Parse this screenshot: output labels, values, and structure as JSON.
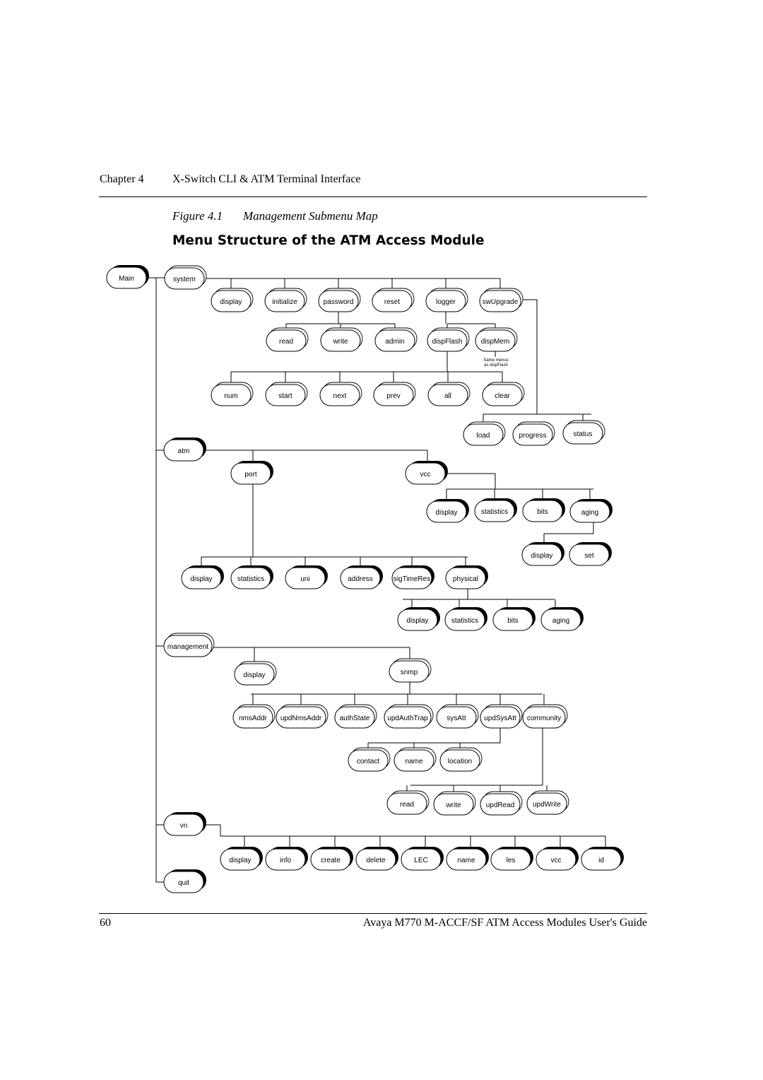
{
  "header": {
    "chapter_label": "Chapter 4",
    "chapter_title": "X-Switch CLI & ATM Terminal Interface"
  },
  "figure": {
    "number": "Figure 4.1",
    "caption": "Management Submenu Map",
    "title": "Menu Structure of the ATM Access Module"
  },
  "footer": {
    "page_number": "60",
    "book_title": "Avaya M770 M-ACCF/SF ATM Access Modules User's Guide"
  },
  "diagram": {
    "node_styles": {
      "menu": "rounded box with heavy black shadow (submenu)",
      "command": "rounded box with double outline (command)"
    },
    "annotation": {
      "text_line1": "Same menus",
      "text_line2": "as dispFlash",
      "attached_to": "dispMem"
    },
    "nodes": [
      {
        "id": "main",
        "label": "Main",
        "style": "menu"
      },
      {
        "id": "system",
        "label": "system",
        "style": "command",
        "parent": "main"
      },
      {
        "id": "sys_display",
        "label": "display",
        "style": "command",
        "parent": "system"
      },
      {
        "id": "sys_initialize",
        "label": "initialize",
        "style": "command",
        "parent": "system"
      },
      {
        "id": "sys_password",
        "label": "password",
        "style": "command",
        "parent": "system"
      },
      {
        "id": "sys_reset",
        "label": "reset",
        "style": "command",
        "parent": "system"
      },
      {
        "id": "sys_logger",
        "label": "logger",
        "style": "command",
        "parent": "system"
      },
      {
        "id": "sys_swupgrade",
        "label": "swUpgrade",
        "style": "command",
        "parent": "system"
      },
      {
        "id": "pw_read",
        "label": "read",
        "style": "command",
        "parent": "sys_password"
      },
      {
        "id": "pw_write",
        "label": "write",
        "style": "command",
        "parent": "sys_password"
      },
      {
        "id": "pw_admin",
        "label": "admin",
        "style": "command",
        "parent": "sys_password"
      },
      {
        "id": "log_dispflash",
        "label": "dispFlash",
        "style": "command",
        "parent": "sys_logger"
      },
      {
        "id": "log_dispmem",
        "label": "dispMem",
        "style": "command",
        "parent": "sys_logger"
      },
      {
        "id": "df_num",
        "label": "num",
        "style": "command",
        "parent": "log_dispflash"
      },
      {
        "id": "df_start",
        "label": "start",
        "style": "command",
        "parent": "log_dispflash"
      },
      {
        "id": "df_next",
        "label": "next",
        "style": "command",
        "parent": "log_dispflash"
      },
      {
        "id": "df_prev",
        "label": "prev",
        "style": "command",
        "parent": "log_dispflash"
      },
      {
        "id": "df_all",
        "label": "all",
        "style": "command",
        "parent": "log_dispflash"
      },
      {
        "id": "df_clear",
        "label": "clear",
        "style": "command",
        "parent": "log_dispflash"
      },
      {
        "id": "sw_load",
        "label": "load",
        "style": "command",
        "parent": "sys_swupgrade"
      },
      {
        "id": "sw_progress",
        "label": "progress",
        "style": "command",
        "parent": "sys_swupgrade"
      },
      {
        "id": "sw_status",
        "label": "status",
        "style": "command",
        "parent": "sys_swupgrade"
      },
      {
        "id": "atm",
        "label": "atm",
        "style": "menu",
        "parent": "main"
      },
      {
        "id": "atm_port",
        "label": "port",
        "style": "menu",
        "parent": "atm"
      },
      {
        "id": "atm_vcc",
        "label": "vcc",
        "style": "menu",
        "parent": "atm"
      },
      {
        "id": "vcc_display",
        "label": "display",
        "style": "menu",
        "parent": "atm_vcc"
      },
      {
        "id": "vcc_statistics",
        "label": "statistics",
        "style": "menu",
        "parent": "atm_vcc"
      },
      {
        "id": "vcc_bits",
        "label": "bits",
        "style": "menu",
        "parent": "atm_vcc"
      },
      {
        "id": "vcc_aging",
        "label": "aging",
        "style": "menu",
        "parent": "atm_vcc"
      },
      {
        "id": "aging_display",
        "label": "display",
        "style": "menu",
        "parent": "vcc_aging"
      },
      {
        "id": "aging_set",
        "label": "set",
        "style": "menu",
        "parent": "vcc_aging"
      },
      {
        "id": "port_display",
        "label": "display",
        "style": "menu",
        "parent": "atm_port"
      },
      {
        "id": "port_statistics",
        "label": "statistics",
        "style": "menu",
        "parent": "atm_port"
      },
      {
        "id": "port_uni",
        "label": "uni",
        "style": "menu",
        "parent": "atm_port"
      },
      {
        "id": "port_address",
        "label": "address",
        "style": "menu",
        "parent": "atm_port"
      },
      {
        "id": "port_sigtimeres",
        "label": "sigTimeRes",
        "style": "menu",
        "parent": "atm_port"
      },
      {
        "id": "port_physical",
        "label": "physical",
        "style": "menu",
        "parent": "atm_port"
      },
      {
        "id": "phy_display",
        "label": "display",
        "style": "menu",
        "parent": "port_physical"
      },
      {
        "id": "phy_statistics",
        "label": "statistics",
        "style": "menu",
        "parent": "port_physical"
      },
      {
        "id": "phy_bits",
        "label": "bits",
        "style": "menu",
        "parent": "port_physical"
      },
      {
        "id": "phy_aging",
        "label": "aging",
        "style": "menu",
        "parent": "port_physical"
      },
      {
        "id": "management",
        "label": "management",
        "style": "command",
        "parent": "main"
      },
      {
        "id": "mgmt_display",
        "label": "display",
        "style": "command",
        "parent": "management"
      },
      {
        "id": "mgmt_snmp",
        "label": "snmp",
        "style": "command",
        "parent": "management"
      },
      {
        "id": "snmp_nmsaddr",
        "label": "nmsAddr",
        "style": "command",
        "parent": "mgmt_snmp"
      },
      {
        "id": "snmp_updnmsaddr",
        "label": "updNmsAddr",
        "style": "command",
        "parent": "mgmt_snmp"
      },
      {
        "id": "snmp_authstate",
        "label": "authState",
        "style": "command",
        "parent": "mgmt_snmp"
      },
      {
        "id": "snmp_updauthtrap",
        "label": "updAuthTrap",
        "style": "command",
        "parent": "mgmt_snmp"
      },
      {
        "id": "snmp_sysatt",
        "label": "sysAtt",
        "style": "command",
        "parent": "mgmt_snmp"
      },
      {
        "id": "snmp_updsysatt",
        "label": "updSysAtt",
        "style": "command",
        "parent": "mgmt_snmp"
      },
      {
        "id": "snmp_community",
        "label": "community",
        "style": "command",
        "parent": "mgmt_snmp"
      },
      {
        "id": "usa_contact",
        "label": "contact",
        "style": "command",
        "parent": "snmp_updsysatt"
      },
      {
        "id": "usa_name",
        "label": "name",
        "style": "command",
        "parent": "snmp_updsysatt"
      },
      {
        "id": "usa_location",
        "label": "location",
        "style": "command",
        "parent": "snmp_updsysatt"
      },
      {
        "id": "com_read",
        "label": "read",
        "style": "command",
        "parent": "snmp_community"
      },
      {
        "id": "com_write",
        "label": "write",
        "style": "command",
        "parent": "snmp_community"
      },
      {
        "id": "com_updread",
        "label": "updRead",
        "style": "command",
        "parent": "snmp_community"
      },
      {
        "id": "com_updwrite",
        "label": "updWrite",
        "style": "command",
        "parent": "snmp_community"
      },
      {
        "id": "vn",
        "label": "vn",
        "style": "menu",
        "parent": "main"
      },
      {
        "id": "vn_display",
        "label": "display",
        "style": "menu",
        "parent": "vn"
      },
      {
        "id": "vn_info",
        "label": "info",
        "style": "menu",
        "parent": "vn"
      },
      {
        "id": "vn_create",
        "label": "create",
        "style": "menu",
        "parent": "vn"
      },
      {
        "id": "vn_delete",
        "label": "delete",
        "style": "menu",
        "parent": "vn"
      },
      {
        "id": "vn_lec",
        "label": "LEC",
        "style": "menu",
        "parent": "vn"
      },
      {
        "id": "vn_name",
        "label": "name",
        "style": "menu",
        "parent": "vn"
      },
      {
        "id": "vn_les",
        "label": "les",
        "style": "menu",
        "parent": "vn"
      },
      {
        "id": "vn_vcc",
        "label": "vcc",
        "style": "menu",
        "parent": "vn"
      },
      {
        "id": "vn_id",
        "label": "id",
        "style": "menu",
        "parent": "vn"
      },
      {
        "id": "quit",
        "label": "quit",
        "style": "menu",
        "parent": "main"
      }
    ]
  }
}
